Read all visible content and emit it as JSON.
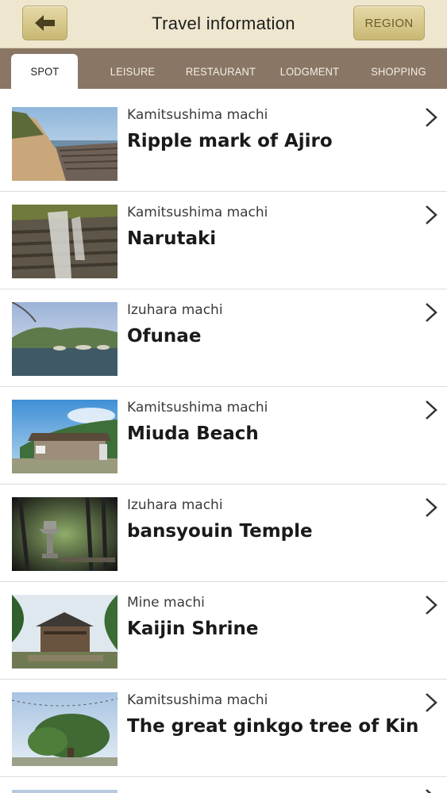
{
  "header": {
    "title": "Travel information",
    "back_icon": "back-arrow-icon",
    "region_label": "REGION"
  },
  "tabs": [
    {
      "label": "SPOT",
      "active": true
    },
    {
      "label": "LEISURE",
      "active": false
    },
    {
      "label": "RESTAURANT",
      "active": false
    },
    {
      "label": "LODGMENT",
      "active": false
    },
    {
      "label": "SHOPPING",
      "active": false
    }
  ],
  "colors": {
    "header_bg": "#efe6cf",
    "tab_bar_bg": "#8a7664",
    "button_gold": "#d4c48a"
  },
  "spots": [
    {
      "region": "Kamitsushima machi",
      "name": "Ripple mark of Ajiro",
      "thumb": "coastal-rocks"
    },
    {
      "region": "Kamitsushima machi",
      "name": "Narutaki",
      "thumb": "waterfall"
    },
    {
      "region": "Izuhara machi",
      "name": "Ofunae",
      "thumb": "harbor"
    },
    {
      "region": "Kamitsushima machi",
      "name": "Miuda Beach",
      "thumb": "beach-pavilion"
    },
    {
      "region": "Izuhara machi",
      "name": "bansyouin Temple",
      "thumb": "temple-lantern"
    },
    {
      "region": "Mine machi",
      "name": "Kaijin Shrine",
      "thumb": "shrine"
    },
    {
      "region": "Kamitsushima machi",
      "name": "The great ginkgo tree of Kin",
      "thumb": "ginkgo-tree"
    }
  ]
}
